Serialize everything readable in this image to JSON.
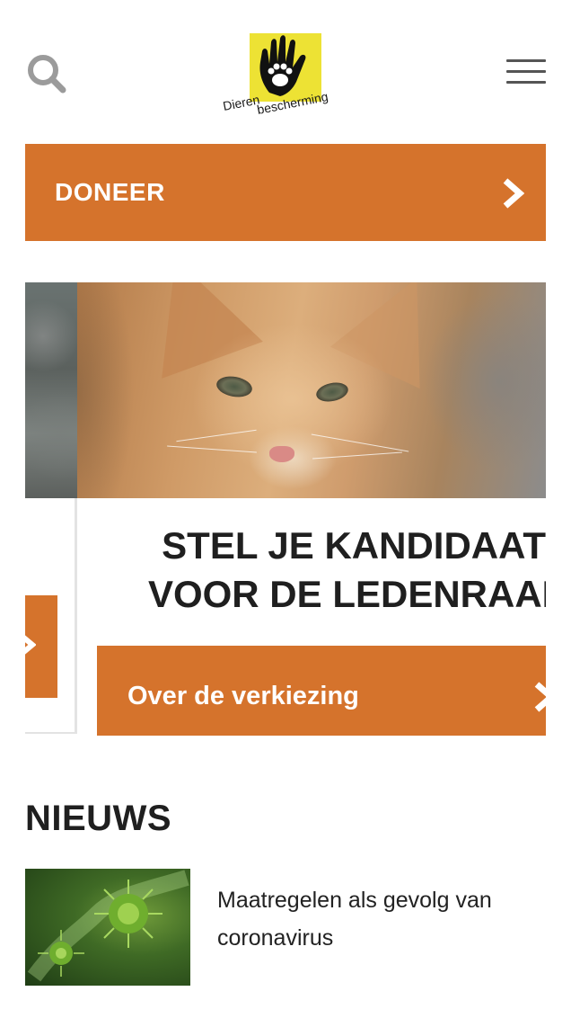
{
  "header": {
    "search_icon": "search-icon",
    "logo": {
      "line1": "Dieren",
      "line2": "bescherming",
      "color": "#ede234"
    },
    "menu_icon": "hamburger-menu-icon"
  },
  "donate": {
    "label": "DONEER",
    "icon": "chevron-right-icon",
    "color": "#d5732c"
  },
  "carousel": {
    "slide": {
      "title_line1": "STEL JE KANDIDAAT",
      "title_line2": "VOOR DE LEDENRAAD",
      "button_label": "Over de verkiezing",
      "image": "kitten-photo"
    }
  },
  "news": {
    "heading": "NIEUWS",
    "items": [
      {
        "title": "Maatregelen als gevolg van coronavirus",
        "image": "coronavirus-illustration"
      }
    ]
  }
}
